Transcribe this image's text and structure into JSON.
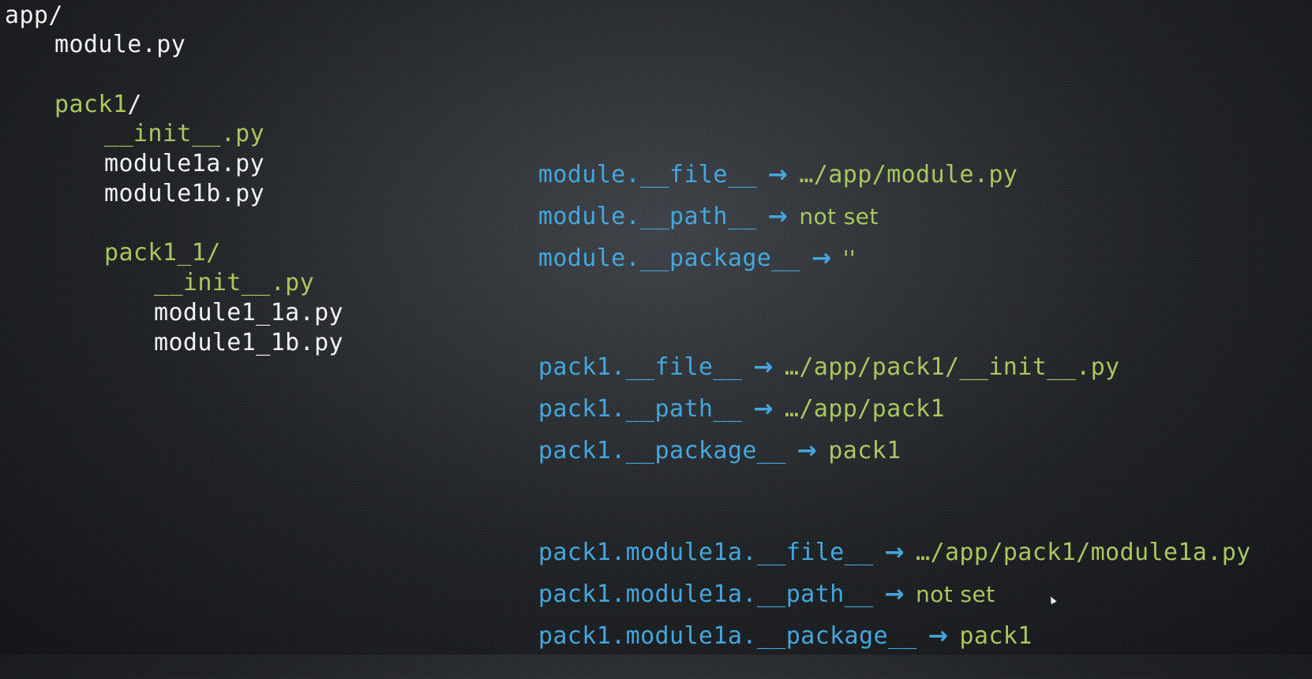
{
  "tree": {
    "root": "app/",
    "module": "module.py",
    "pack1_name": "pack1",
    "pack1_slash": "/",
    "pack1_init": "__init__.py",
    "module1a": "module1a.py",
    "module1b": "module1b.py",
    "pack1_1": "pack1_1/",
    "pack1_1_init": "__init__.py",
    "module1_1a": "module1_1a.py",
    "module1_1b": "module1_1b.py"
  },
  "arrow": "→",
  "module_section": {
    "file": {
      "attr": "module.__file__",
      "value": "…/app/module.py"
    },
    "path": {
      "attr": "module.__path__",
      "value": "not set"
    },
    "package": {
      "attr": "module.__package__",
      "value": "''"
    }
  },
  "pack1_section": {
    "file": {
      "attr": "pack1.__file__",
      "value": "…/app/pack1/__init__.py"
    },
    "path": {
      "attr": "pack1.__path__",
      "value": "…/app/pack1"
    },
    "package": {
      "attr": "pack1.__package__",
      "value": "pack1"
    }
  },
  "module1a_section": {
    "file": {
      "attr": "pack1.module1a.__file__",
      "value": "…/app/pack1/module1a.py"
    },
    "path": {
      "attr": "pack1.module1a.__path__",
      "value": "not set"
    },
    "package": {
      "attr": "pack1.module1a.__package__",
      "value": "pack1"
    }
  },
  "colors": {
    "background": "#2e3236",
    "white_text": "#f2f2f2",
    "green_text": "#a9c75e",
    "blue_text": "#45a6dc"
  }
}
